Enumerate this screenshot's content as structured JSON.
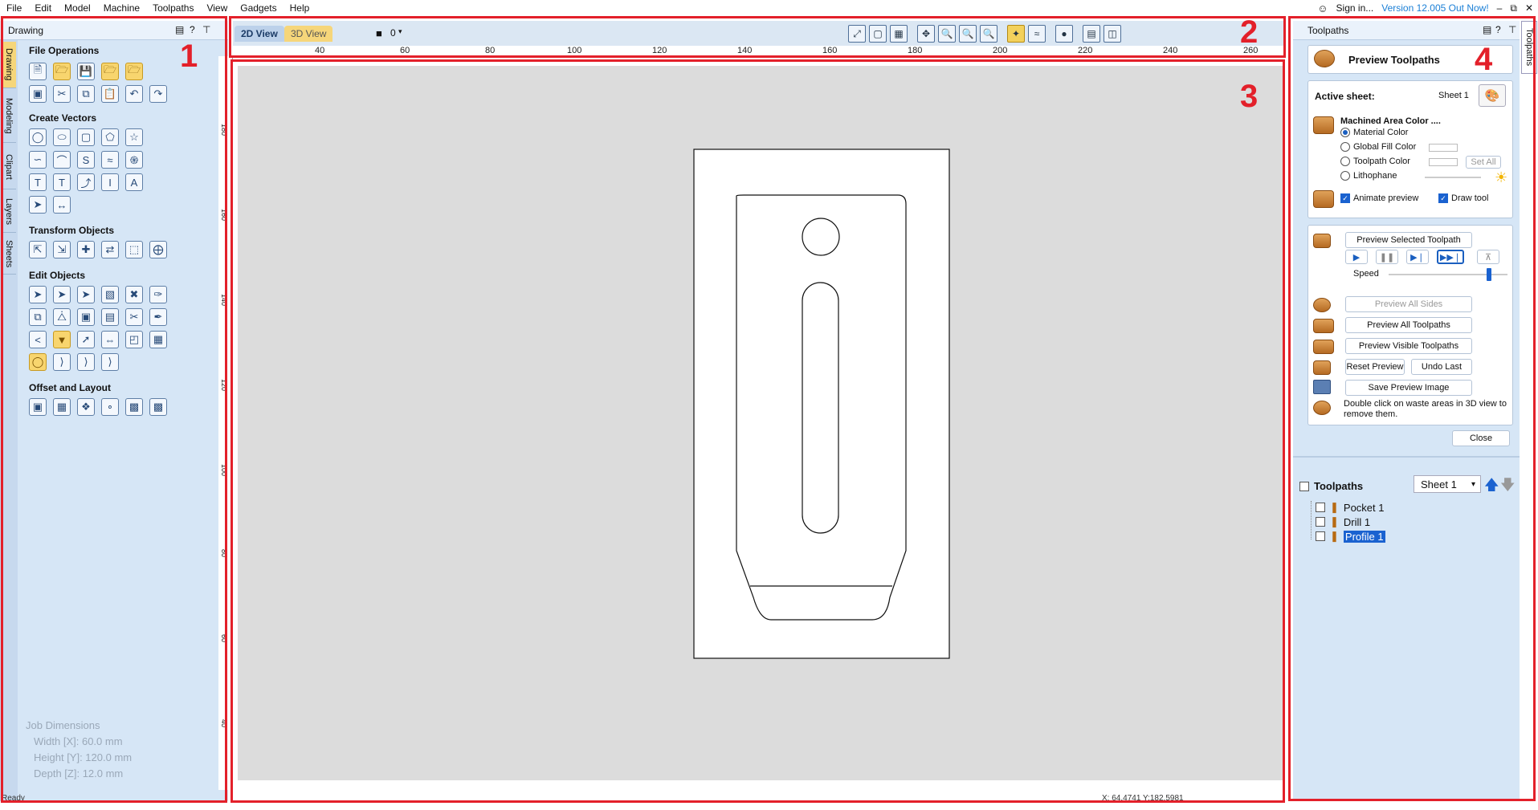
{
  "menu": [
    "File",
    "Edit",
    "Model",
    "Machine",
    "Toolpaths",
    "View",
    "Gadgets",
    "Help"
  ],
  "account": {
    "sign_in": "Sign in...",
    "version": "Version 12.005 Out Now!"
  },
  "window_controls": [
    "–",
    "⧉",
    "✕"
  ],
  "left_panel": {
    "title": "Drawing",
    "vertical_tabs": [
      "Drawing",
      "Modeling",
      "Clipart",
      "Layers",
      "Sheets"
    ],
    "sections": [
      "File Operations",
      "Create Vectors",
      "Transform Objects",
      "Edit Objects",
      "Offset and Layout"
    ],
    "job_dimensions": {
      "title": "Job Dimensions",
      "width": "Width  [X]: 60.0 mm",
      "height": "Height [Y]: 120.0 mm",
      "depth": "Depth  [Z]: 12.0 mm"
    }
  },
  "view_tabs": {
    "view2d": "2D View",
    "view3d": "3D View",
    "layer_value": "0"
  },
  "ruler": {
    "h_ticks": [
      "40",
      "60",
      "80",
      "100",
      "120",
      "140",
      "160",
      "180",
      "200",
      "220",
      "240",
      "260"
    ],
    "v_ticks": [
      "180",
      "160",
      "140",
      "120",
      "100",
      "80",
      "60",
      "40",
      "20"
    ]
  },
  "annotations": {
    "n1": "1",
    "n2": "2",
    "n3": "3",
    "n4": "4"
  },
  "right_panel": {
    "title": "Toolpaths",
    "vertical_tab": "Toolpaths",
    "preview_title": "Preview Toolpaths",
    "active_sheet_label": "Active sheet:",
    "active_sheet_value": "Sheet 1",
    "machined_area": "Machined Area Color ....",
    "options": [
      "Material Color",
      "Global Fill Color",
      "Toolpath Color",
      "Lithophane"
    ],
    "set_all": "Set All",
    "animate": "Animate preview",
    "draw_tool": "Draw tool",
    "preview_selected": "Preview Selected Toolpath",
    "speed": "Speed",
    "speed_value": 1.0,
    "preview_all_sides": "Preview All Sides",
    "preview_all_toolpaths": "Preview All Toolpaths",
    "preview_visible": "Preview Visible Toolpaths",
    "reset_preview": "Reset Preview",
    "undo_last": "Undo Last",
    "save_preview": "Save Preview Image",
    "hint": "Double click on waste areas in 3D view to remove them.",
    "close": "Close",
    "toolpaths_header": "Toolpaths",
    "sheet_select": "Sheet 1",
    "toolpaths": [
      "Pocket 1",
      "Drill 1",
      "Profile 1"
    ]
  },
  "status": {
    "left": "Ready",
    "coords": "X: 64.4741 Y:182.5981"
  }
}
